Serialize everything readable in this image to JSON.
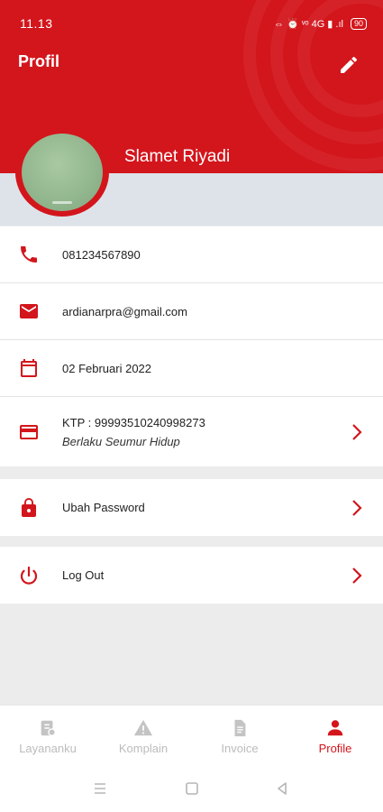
{
  "status_bar": {
    "time": "11.13",
    "icons": "⇔ ⏰ ᵛᵒ 4G ▮ .ıl",
    "battery": "90"
  },
  "header": {
    "title": "Profil"
  },
  "profile": {
    "name": "Slamet Riyadi"
  },
  "info": {
    "phone": "081234567890",
    "email": "ardianarpra@gmail.com",
    "date": "02 Februari 2022",
    "ktp": "KTP : 99993510240998273",
    "ktp_validity": "Berlaku Seumur Hidup"
  },
  "actions": {
    "change_password": "Ubah Password",
    "logout": "Log Out"
  },
  "nav": {
    "items": [
      {
        "label": "Layananku",
        "icon": "services-icon"
      },
      {
        "label": "Komplain",
        "icon": "warning-icon"
      },
      {
        "label": "Invoice",
        "icon": "document-icon"
      },
      {
        "label": "Profile",
        "icon": "person-icon"
      }
    ],
    "active": "Profile"
  },
  "colors": {
    "primary": "#d3151c",
    "inactive": "#bcbcbc",
    "background": "#ececec"
  }
}
